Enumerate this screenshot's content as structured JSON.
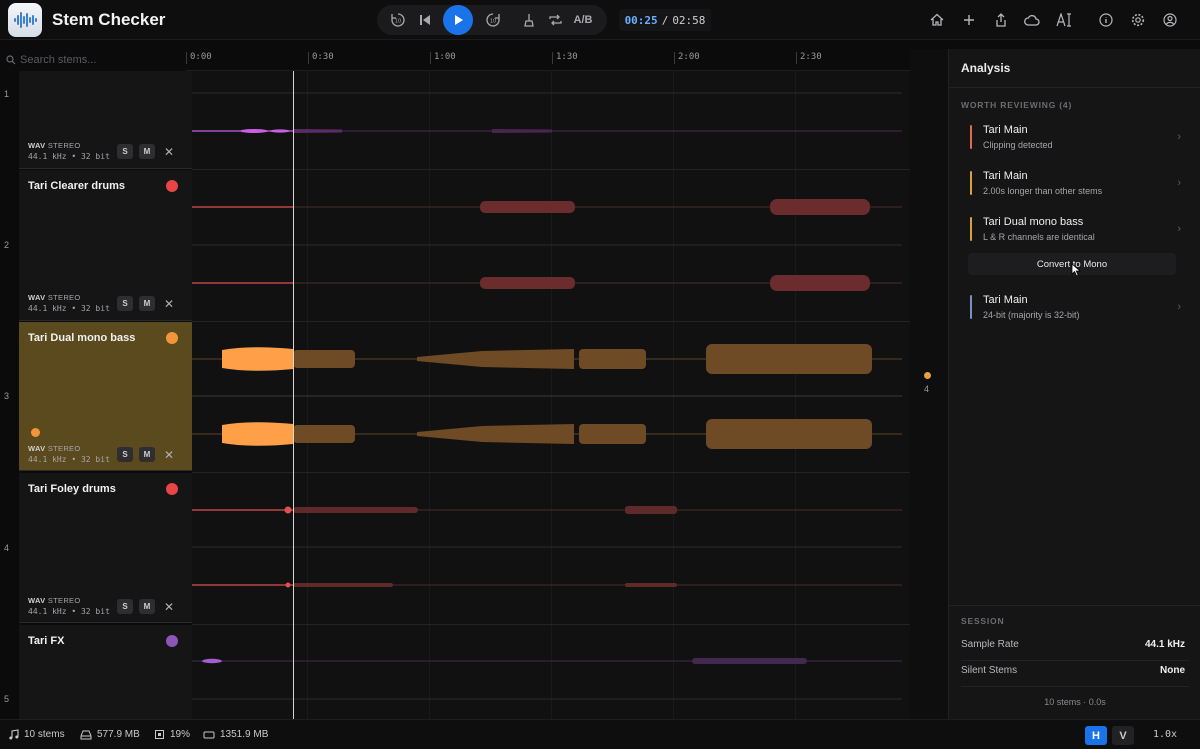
{
  "app": {
    "title": "Stem Checker"
  },
  "transport": {
    "ab_label": "A/B",
    "time_current": "00:25",
    "time_separator": "/",
    "time_total": "02:58"
  },
  "toolbar_icons": [
    "home-icon",
    "plus-icon",
    "share-icon",
    "cloud-icon",
    "text-size-icon",
    "info-icon",
    "settings-icon",
    "account-icon"
  ],
  "search": {
    "placeholder": "Search stems..."
  },
  "timeline": {
    "ticks": [
      "0:00",
      "0:30",
      "1:00",
      "1:30",
      "2:00",
      "2:30"
    ]
  },
  "tracks": [
    {
      "num": "1",
      "name": "",
      "color": "#b65bd8",
      "format": "WAV",
      "channels": "STEREO",
      "info": "44.1 kHz • 32 bit",
      "solo": "S",
      "mute": "M"
    },
    {
      "num": "2",
      "name": "Tari Clearer drums",
      "color": "#e84545",
      "format": "WAV",
      "channels": "STEREO",
      "info": "44.1 kHz • 32 bit",
      "solo": "S",
      "mute": "M"
    },
    {
      "num": "3",
      "name": "Tari Dual mono bass",
      "color": "#f2953a",
      "format": "WAV",
      "channels": "STEREO",
      "info": "44.1 kHz • 32 bit",
      "solo": "S",
      "mute": "M",
      "selected": true
    },
    {
      "num": "4",
      "name": "Tari Foley drums",
      "color": "#e84545",
      "format": "WAV",
      "channels": "STEREO",
      "info": "44.1 kHz • 32 bit",
      "solo": "S",
      "mute": "M"
    },
    {
      "num": "5",
      "name": "Tari FX",
      "color": "#8e55b8"
    }
  ],
  "gutter": {
    "count": "4"
  },
  "analysis": {
    "title": "Analysis",
    "section_label": "WORTH REVIEWING",
    "section_count": "(4)",
    "issues": [
      {
        "title": "Tari Main",
        "subtitle": "Clipping detected",
        "color": "#e06a4e"
      },
      {
        "title": "Tari Main",
        "subtitle": "2.00s longer than other stems",
        "color": "#d9a044"
      },
      {
        "title": "Tari Dual mono bass",
        "subtitle": "L & R channels are identical",
        "color": "#d9a044"
      },
      {
        "title": "Tari Main",
        "subtitle": "24-bit (majority is 32-bit)",
        "color": "#7a8fc4"
      }
    ],
    "convert_button": "Convert to Mono",
    "session_label": "SESSION",
    "session": [
      {
        "key": "Sample Rate",
        "value": "44.1 kHz"
      },
      {
        "key": "Silent Stems",
        "value": "None"
      }
    ],
    "footer": "10 stems · 0.0s"
  },
  "status": {
    "stems": "10 stems",
    "size": "577.9 MB",
    "cpu": "19%",
    "memory": "1351.9 MB",
    "h_label": "H",
    "v_label": "V",
    "zoom": "1.0x"
  }
}
